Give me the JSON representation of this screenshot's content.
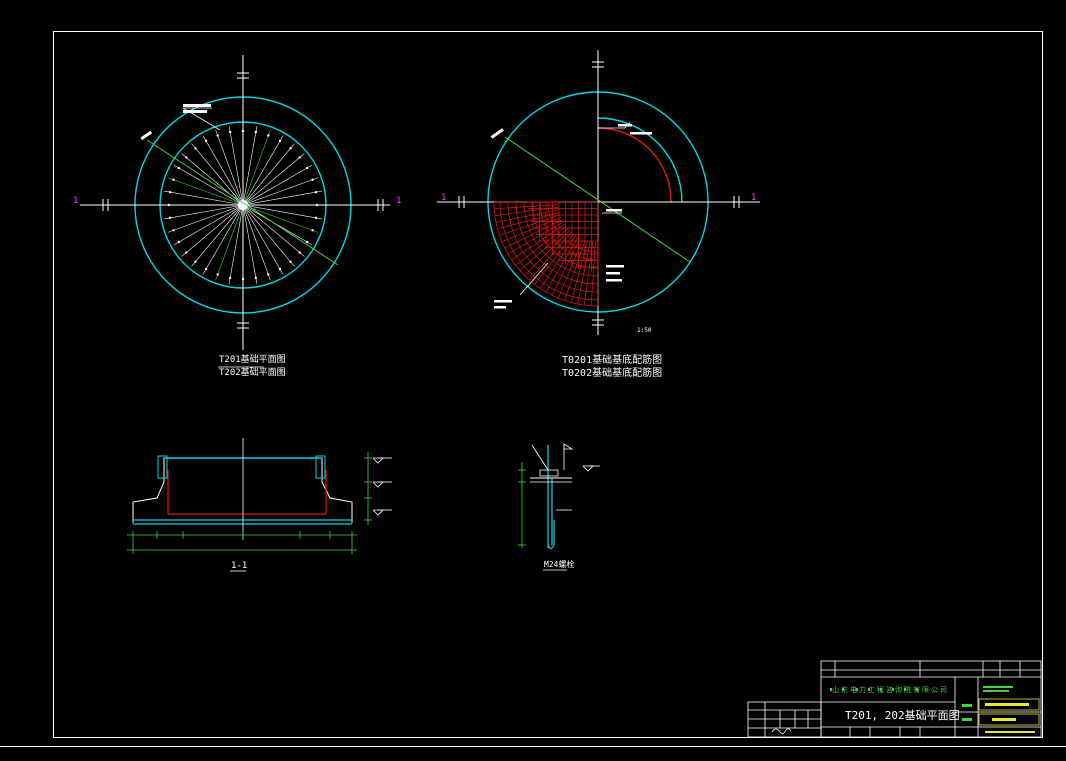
{
  "colors": {
    "background": "#000000",
    "frame": "#ffffff",
    "cyan": "#00d8e8",
    "green": "#3fd43f",
    "red": "#e01818",
    "magenta": "#ff40ff",
    "yellow": "#e8e830"
  },
  "views": {
    "plan_left": {
      "caption_1": "T201基础平面图",
      "caption_2": "T202基础平面图",
      "section_mark": "1"
    },
    "plan_right": {
      "caption_1": "T0201基础基底配筋图",
      "caption_2": "T0202基础基底配筋图",
      "section_mark": "1",
      "scale_note": "1:50"
    },
    "section": {
      "caption": "1-1"
    },
    "detail": {
      "caption": "M24螺栓"
    }
  },
  "title_block": {
    "company": "山东电力工程咨询院有限公司",
    "drawing_title": "T201, 202基础平面图"
  }
}
